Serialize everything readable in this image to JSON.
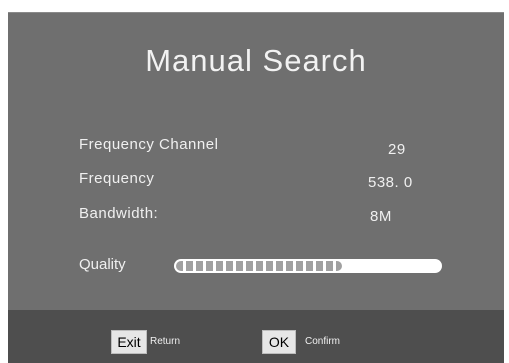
{
  "screen": {
    "title": "Manual Search"
  },
  "rows": [
    {
      "label": "Frequency Channel",
      "value": "29"
    },
    {
      "label": "Frequency",
      "value": "538. 0"
    },
    {
      "label": "Bandwidth:",
      "value": "8M"
    }
  ],
  "quality": {
    "label": "Quality",
    "level_fraction": 0.63
  },
  "footer": {
    "exit_key": "Exit",
    "exit_desc": "Return",
    "ok_key": "OK",
    "ok_desc": "Confirm"
  },
  "colors": {
    "panel": "#6f6f6f",
    "footer": "#4e4e4e",
    "text": "#f0f0f0",
    "quality_dot": "#a0a0a0"
  }
}
